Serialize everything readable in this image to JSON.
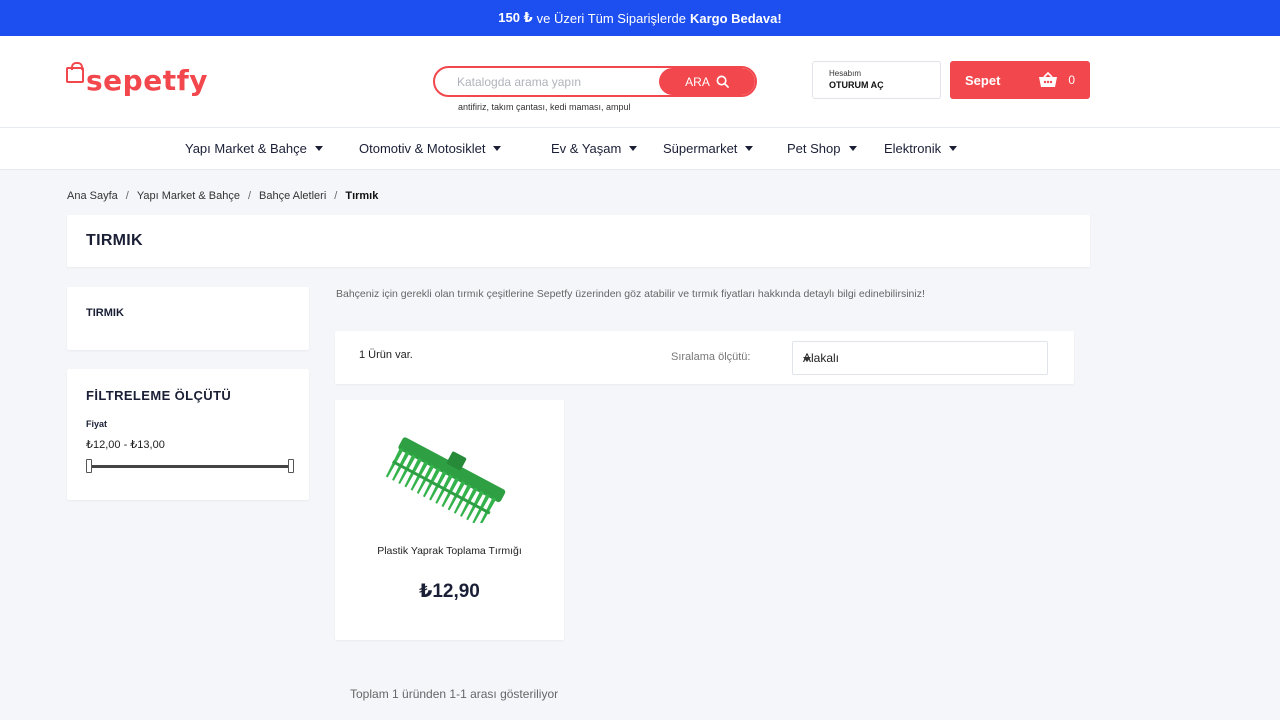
{
  "promo": {
    "amount": "150 ₺",
    "text": "ve Üzeri Tüm Siparişlerde",
    "highlight": "Kargo Bedava!"
  },
  "brand": {
    "name": "sepetfy",
    "color": "#f2474c"
  },
  "search": {
    "placeholder": "Katalogda arama yapın",
    "button_label": "ARA",
    "hints": "antifiriz, takım çantası, kedi maması, ampul"
  },
  "account": {
    "label": "Hesabım",
    "action": "OTURUM AÇ"
  },
  "cart": {
    "label": "Sepet",
    "count": "0"
  },
  "nav": [
    {
      "label": "Yapı Market & Bahçe"
    },
    {
      "label": "Otomotiv & Motosiklet"
    },
    {
      "label": "Ev & Yaşam"
    },
    {
      "label": "Süpermarket"
    },
    {
      "label": "Pet Shop"
    },
    {
      "label": "Elektronik"
    }
  ],
  "breadcrumb": {
    "home": "Ana Sayfa",
    "level1": "Yapı Market & Bahçe",
    "level2": "Bahçe Aletleri",
    "current": "Tırmık"
  },
  "page_title": "TIRMIK",
  "sidebar": {
    "category": "TIRMIK"
  },
  "filter": {
    "title": "FİLTRELEME ÖLÇÜTÜ",
    "price_label": "Fiyat",
    "price_range": "₺12,00 - ₺13,00"
  },
  "description": "Bahçeniz için gerekli olan tırmık çeşitlerine Sepetfy üzerinden göz atabilir ve tırmık fiyatları hakkında detaylı bilgi edinebilirsiniz!",
  "sort": {
    "count_text": "1 Ürün var.",
    "label": "Sıralama ölçütü:",
    "selected": "Alakalı"
  },
  "products": [
    {
      "name": "Plastik Yaprak Toplama Tırmığı",
      "price": "₺12,90",
      "image_icon": "green-rake"
    }
  ],
  "pagination": {
    "summary": "Toplam 1 üründen 1-1 arası gösteriliyor"
  },
  "colors": {
    "topbar": "#1d4ef0",
    "accent": "#f2474c",
    "rake_green": "#2ea043"
  }
}
